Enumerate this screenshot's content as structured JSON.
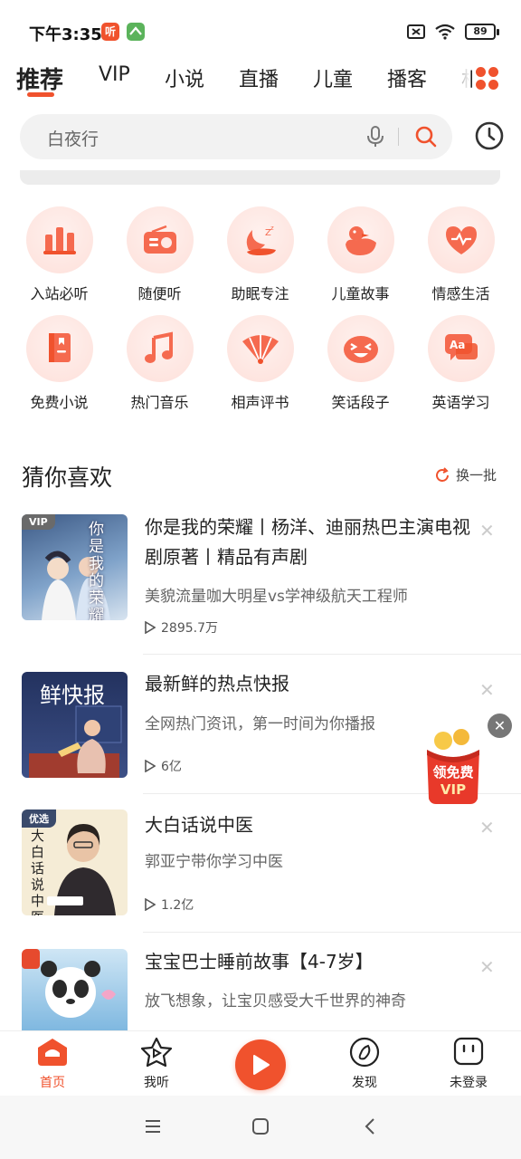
{
  "status": {
    "time": "下午3:35",
    "app1": "听",
    "battery": "89"
  },
  "tabs": [
    "推荐",
    "VIP",
    "小说",
    "直播",
    "儿童",
    "播客",
    "相"
  ],
  "search": {
    "placeholder": "白夜行"
  },
  "categories": [
    {
      "label": "入站必听",
      "icon": "bar-chart-icon"
    },
    {
      "label": "随便听",
      "icon": "radio-icon"
    },
    {
      "label": "助眠专注",
      "icon": "moon-icon"
    },
    {
      "label": "儿童故事",
      "icon": "duck-icon"
    },
    {
      "label": "情感生活",
      "icon": "heart-icon"
    },
    {
      "label": "免费小说",
      "icon": "book-icon"
    },
    {
      "label": "热门音乐",
      "icon": "music-note-icon"
    },
    {
      "label": "相声评书",
      "icon": "fan-icon"
    },
    {
      "label": "笑话段子",
      "icon": "laugh-face-icon"
    },
    {
      "label": "英语学习",
      "icon": "english-chat-icon"
    }
  ],
  "section": {
    "title": "猜你喜欢",
    "refresh": "换一批"
  },
  "feed": [
    {
      "title": "你是我的荣耀丨杨洋、迪丽热巴主演电视剧原著丨精品有声剧",
      "desc": "美貌流量咖大明星vs学神级航天工程师",
      "plays": "2895.7万",
      "badge": "VIP",
      "cover_text": "你是我的荣耀"
    },
    {
      "title": "最新鲜的热点快报",
      "desc": "全网热门资讯，第一时间为你播报",
      "plays": "6亿",
      "cover_text": "鲜快报"
    },
    {
      "title": "大白话说中医",
      "desc": "郭亚宁带你学习中医",
      "plays": "1.2亿",
      "badge": "优选",
      "cover_text": "大白话说中医"
    },
    {
      "title": "宝宝巴士睡前故事【4-7岁】",
      "desc": "放飞想象，让宝贝感受大千世界的神奇",
      "plays": ""
    }
  ],
  "float_vip": {
    "line1": "领免费",
    "line2": "VIP"
  },
  "bottom_nav": [
    {
      "label": "首页",
      "icon": "home-icon"
    },
    {
      "label": "我听",
      "icon": "star-play-icon"
    },
    {
      "label": "发现",
      "icon": "compass-icon"
    },
    {
      "label": "未登录",
      "icon": "profile-face-icon"
    }
  ],
  "colors": {
    "accent": "#f0522d"
  }
}
